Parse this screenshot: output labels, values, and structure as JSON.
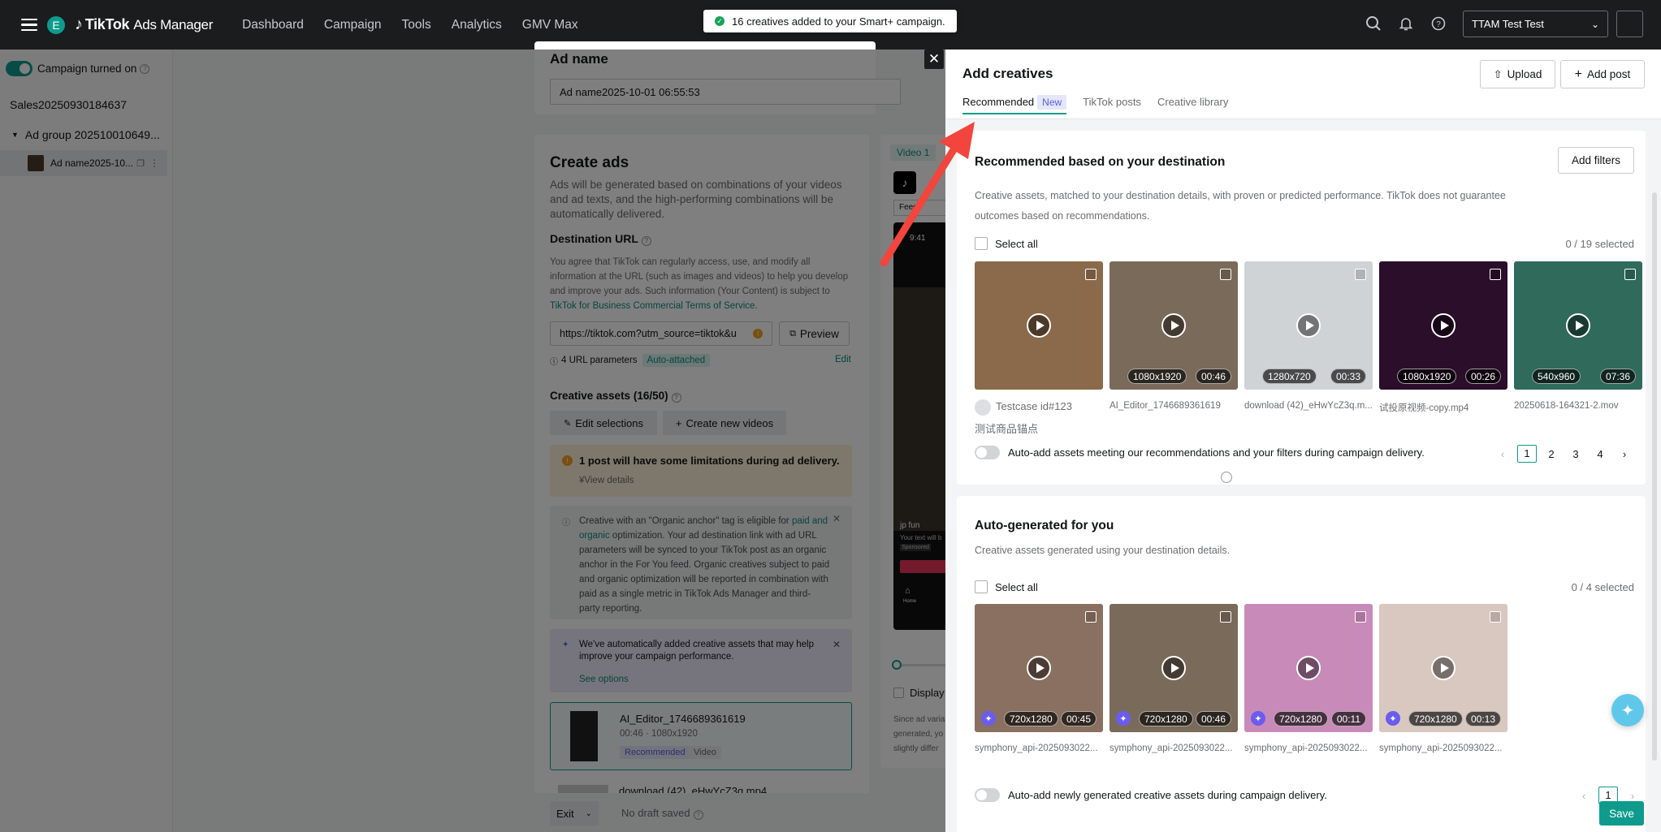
{
  "topbar": {
    "avatar_letter": "E",
    "brand": "TikTok",
    "brand_sub": "Ads Manager",
    "nav": [
      "Dashboard",
      "Campaign",
      "Tools",
      "Analytics",
      "GMV Max"
    ],
    "toast": "16 creatives added to your Smart+ campaign.",
    "account": "TTAM Test Test",
    "icons": [
      "search-icon",
      "bell-icon",
      "help-icon"
    ]
  },
  "sidebar": {
    "campaign_status": "Campaign turned on",
    "campaign_name": "Sales20250930184637",
    "ad_group": "Ad group 202510010649...",
    "ad": "Ad name2025-10..."
  },
  "main": {
    "ad_name_label": "Ad name",
    "ad_name_value": "Ad name2025-10-01 06:55:53",
    "create_ads_title": "Create ads",
    "create_ads_desc": "Ads will be generated based on combinations of your videos and ad texts, and the high-performing combinations will be automatically delivered.",
    "dest_label": "Destination URL",
    "dest_desc": "You agree that TikTok can regularly access, use, and modify all information at the URL (such as images and videos) to help you develop and improve your ads. Such information (Your Content) is subject to",
    "dest_link": "TikTok for Business Commercial Terms of Service",
    "dest_desc_end": ".",
    "url_value": "https://tiktok.com?utm_source=tiktok&u",
    "preview": "Preview",
    "url_params": "4 URL parameters",
    "auto_attached": "Auto-attached",
    "edit": "Edit",
    "creative_assets": "Creative assets (16/50)",
    "edit_selections": "Edit selections",
    "create_new_videos": "Create new videos",
    "warning_title": "1 post will have some limitations during ad delivery.",
    "view_details": "View details",
    "organic_text_a": "Creative with an \"Organic anchor\" tag is eligible for",
    "organic_link": "paid and organic",
    "organic_text_b": "optimization. Your ad destination link with ad URL parameters will be synced to your TikTok post as an organic anchor in the For You feed. Organic creatives subject to paid and organic optimization will be reported in combination with paid as a single metric in TikTok Ads Manager and third-party reporting.",
    "auto_added_text": "We've automatically added creative assets that may help improve your campaign performance.",
    "see_options": "See options",
    "asset1_name": "AI_Editor_1746689361619",
    "asset1_meta": "00:46 · 1080x1920",
    "asset1_tag1": "Recommended",
    "asset1_tag2": "Video",
    "asset2_name": "download (42)_eHwYcZ3q.mp4",
    "exit": "Exit",
    "draft": "No draft saved",
    "preview_tab": "Video 1",
    "feed": "Feed",
    "phone_time": "9:41",
    "phone_user": "jp fun",
    "phone_caption": "Your text will b",
    "phone_sponsored": "Sponsored",
    "phone_home": "Home",
    "display_label": "Display",
    "preview_note": "Since ad varia generated, yo slightly differ"
  },
  "panel": {
    "title": "Add creatives",
    "upload": "Upload",
    "add_post": "Add post",
    "tabs": [
      {
        "label": "Recommended",
        "badge": "New"
      },
      {
        "label": "TikTok posts"
      },
      {
        "label": "Creative library"
      }
    ],
    "rec": {
      "title": "Recommended based on your destination",
      "add_filters": "Add filters",
      "desc": "Creative assets, matched to your destination details, with proven or predicted performance. TikTok does not guarantee outcomes based on recommendations.",
      "select_all": "Select all",
      "selected": "0 / 19 selected",
      "items": [
        {
          "name": "Testcase id#123",
          "sub": "测试商品锚点",
          "res": "",
          "dur": "",
          "color": "#8a6a4a"
        },
        {
          "name": "AI_Editor_1746689361619",
          "sub": "",
          "res": "1080x1920",
          "dur": "00:46",
          "color": "#7a6a5a"
        },
        {
          "name": "download (42)_eHwYcZ3q.m...",
          "sub": "",
          "res": "1280x720",
          "dur": "00:33",
          "color": "#cfd3d6"
        },
        {
          "name": "试投原视频-copy.mp4",
          "sub": "",
          "res": "1080x1920",
          "dur": "00:26",
          "color": "#2a0e2a"
        },
        {
          "name": "20250618-164321-2.mov",
          "sub": "",
          "res": "540x960",
          "dur": "07:36",
          "color": "#2f6a5a"
        }
      ],
      "auto_add": "Auto-add assets meeting our recommendations and your filters during campaign delivery.",
      "pages": [
        "1",
        "2",
        "3",
        "4"
      ]
    },
    "gen": {
      "title": "Auto-generated for you",
      "desc": "Creative assets generated using your destination details.",
      "select_all": "Select all",
      "selected": "0 / 4 selected",
      "items": [
        {
          "name": "symphony_api-2025093022...",
          "res": "720x1280",
          "dur": "00:45",
          "color": "#8a7060"
        },
        {
          "name": "symphony_api-2025093022...",
          "res": "720x1280",
          "dur": "00:46",
          "color": "#7a6a5a"
        },
        {
          "name": "symphony_api-2025093022...",
          "res": "720x1280",
          "dur": "00:11",
          "color": "#c88ab8"
        },
        {
          "name": "symphony_api-2025093022...",
          "res": "720x1280",
          "dur": "00:13",
          "color": "#d8c8c0"
        }
      ],
      "auto_add": "Auto-add newly generated creative assets during campaign delivery.",
      "pages": [
        "1"
      ]
    },
    "save": "Save"
  },
  "colors": {
    "accent": "#0e9b8d",
    "arrow": "#f2453d",
    "toast_ok": "#19a35a"
  }
}
